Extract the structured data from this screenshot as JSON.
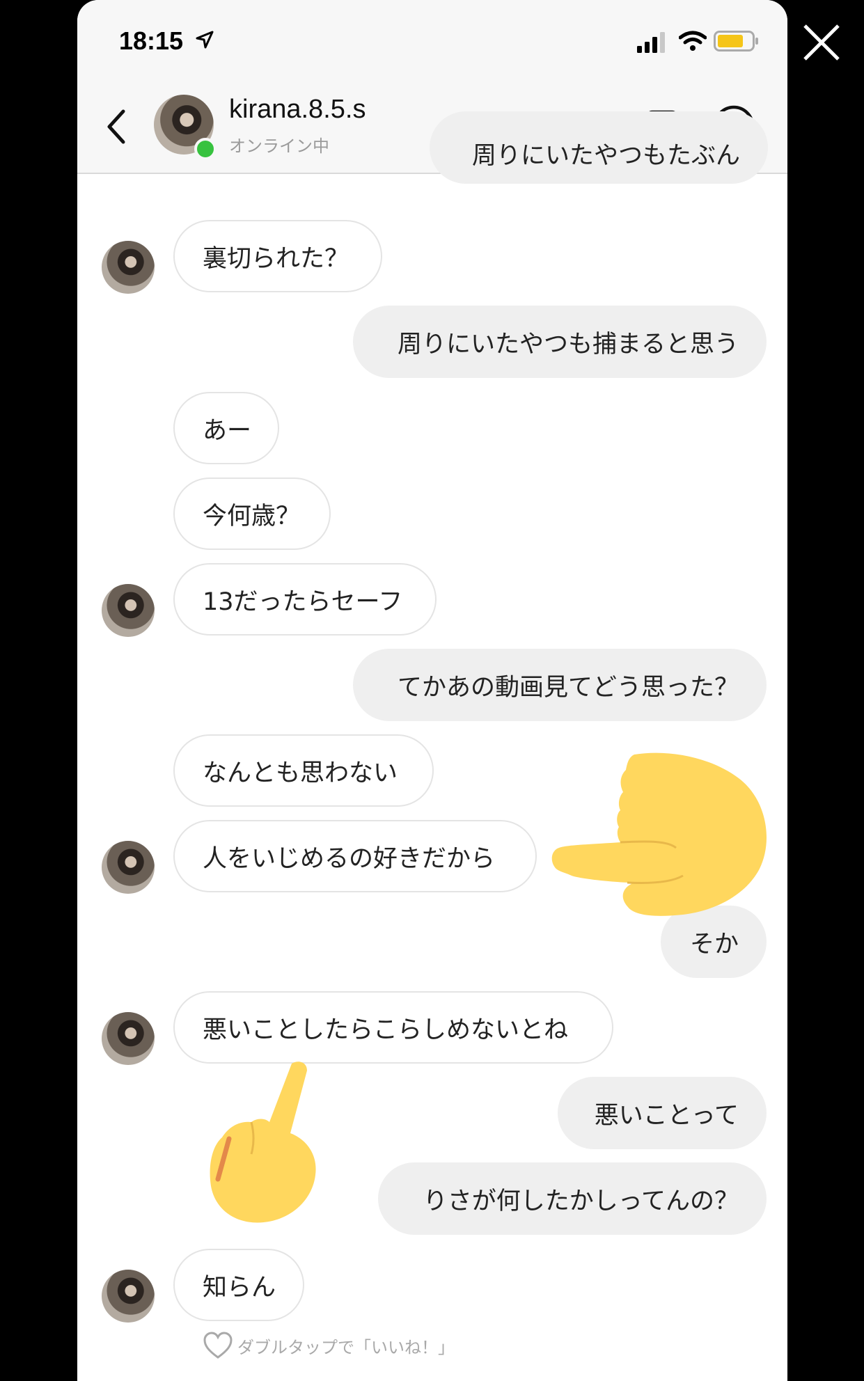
{
  "status_bar": {
    "time": "18:15"
  },
  "header": {
    "username": "kirana.8.5.s",
    "status": "オンライン中"
  },
  "messages": [
    {
      "side": "out",
      "text": "周りにいたやつもたぶん"
    },
    {
      "side": "in",
      "text": "裏切られた？"
    },
    {
      "side": "out",
      "text": "周りにいたやつも捕まると思う"
    },
    {
      "side": "in",
      "text": "あー"
    },
    {
      "side": "in",
      "text": "今何歳？"
    },
    {
      "side": "in",
      "text": "13だったらセーフ"
    },
    {
      "side": "out",
      "text": "てかあの動画見てどう思った？"
    },
    {
      "side": "in",
      "text": "なんとも思わない"
    },
    {
      "side": "in",
      "text": "人をいじめるの好きだから"
    },
    {
      "side": "out",
      "text": "そか"
    },
    {
      "side": "in",
      "text": "悪いことしたらこらしめないとね"
    },
    {
      "side": "out",
      "text": "悪いことって"
    },
    {
      "side": "out",
      "text": "りさが何したかしってんの？"
    },
    {
      "side": "in",
      "text": "知らん"
    }
  ],
  "like_hint": "ダブルタップで「いいね！」",
  "icons": {
    "close": "close-icon",
    "back": "chevron-left-icon",
    "video": "video-camera-icon",
    "info": "info-icon",
    "heart": "heart-icon",
    "pointing_left": "pointing-left-hand-emoji",
    "middle_finger": "middle-finger-emoji"
  },
  "colors": {
    "online": "#37c23f",
    "battery": "#f5c518",
    "emoji_yellow": "#ffd75e",
    "incoming_bubble": "#ffffff",
    "outgoing_bubble": "#efefef"
  }
}
